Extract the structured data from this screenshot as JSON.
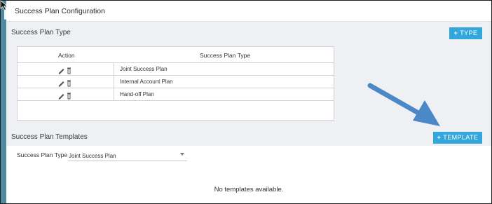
{
  "page": {
    "title": "Success Plan Configuration"
  },
  "types_section": {
    "title": "Success Plan Type",
    "add_button_label": "TYPE",
    "add_button_plus": "+",
    "table": {
      "columns": [
        "Action",
        "Success Plan Type"
      ],
      "rows": [
        {
          "type": "Joint Success Plan"
        },
        {
          "type": "Internal Account Plan"
        },
        {
          "type": "Hand-off Plan"
        }
      ]
    }
  },
  "templates_section": {
    "title": "Success Plan Templates",
    "add_button_label": "TEMPLATE",
    "add_button_plus": "+",
    "filter": {
      "label": "Success Plan Type",
      "selected": "Joint Success Plan"
    },
    "empty_message": "No templates available."
  },
  "icons": {
    "edit": "pencil-icon",
    "delete": "trash-icon",
    "expand": "chevron-double-right-icon",
    "cursor": "mouse-pointer-icon",
    "annotation": "blue-arrow-annotation"
  },
  "colors": {
    "accent": "#33a7dc",
    "section_bg": "#eef0f3",
    "rail": "#4f8a9e",
    "annotation_arrow": "#4a88c7"
  }
}
